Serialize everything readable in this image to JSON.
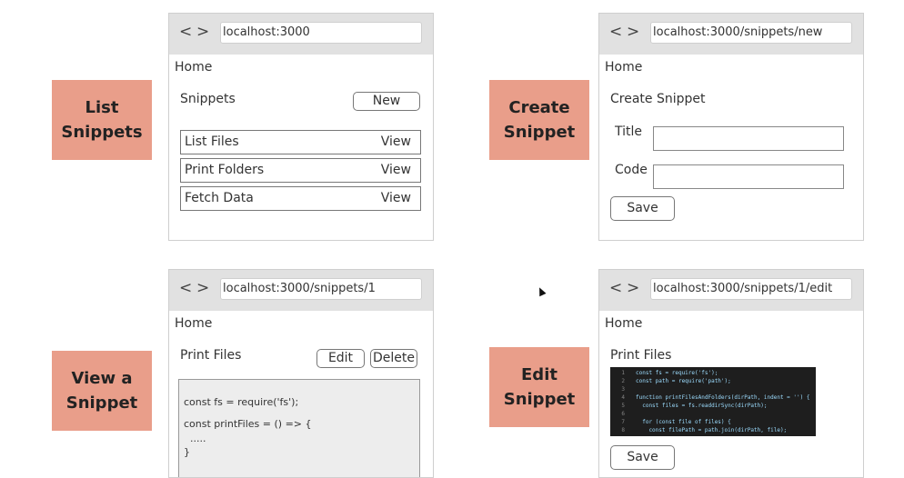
{
  "labels": {
    "list": [
      "List",
      "Snippets"
    ],
    "create": [
      "Create",
      "Snippet"
    ],
    "view": [
      "View a",
      "Snippet"
    ],
    "edit": [
      "Edit",
      "Snippet"
    ]
  },
  "nav": {
    "back": "<",
    "forward": ">"
  },
  "home": "Home",
  "list_browser": {
    "url": "localhost:3000",
    "title": "Snippets",
    "new_label": "New",
    "rows": [
      {
        "name": "List Files",
        "action": "View"
      },
      {
        "name": "Print Folders",
        "action": "View"
      },
      {
        "name": "Fetch Data",
        "action": "View"
      }
    ]
  },
  "create_browser": {
    "url": "localhost:3000/snippets/new",
    "title": "Create Snippet",
    "title_label": "Title",
    "code_label": "Code",
    "save_label": "Save"
  },
  "view_browser": {
    "url": "localhost:3000/snippets/1",
    "title": "Print Files",
    "edit_label": "Edit",
    "delete_label": "Delete",
    "code_lines": [
      "const fs = require('fs');",
      "",
      "const printFiles = () => {",
      "  .....",
      "}"
    ]
  },
  "edit_browser": {
    "url": "localhost:3000/snippets/1/edit",
    "title": "Print Files",
    "save_label": "Save",
    "editor_lines": [
      {
        "num": "1",
        "text": "const fs = require('fs');"
      },
      {
        "num": "2",
        "text": "const path = require('path');"
      },
      {
        "num": "3",
        "text": ""
      },
      {
        "num": "4",
        "text": "function printFilesAndFolders(dirPath, indent = '') {"
      },
      {
        "num": "5",
        "text": "  const files = fs.readdirSync(dirPath);"
      },
      {
        "num": "6",
        "text": ""
      },
      {
        "num": "7",
        "text": "  for (const file of files) {"
      },
      {
        "num": "8",
        "text": "    const filePath = path.join(dirPath, file);"
      }
    ]
  }
}
